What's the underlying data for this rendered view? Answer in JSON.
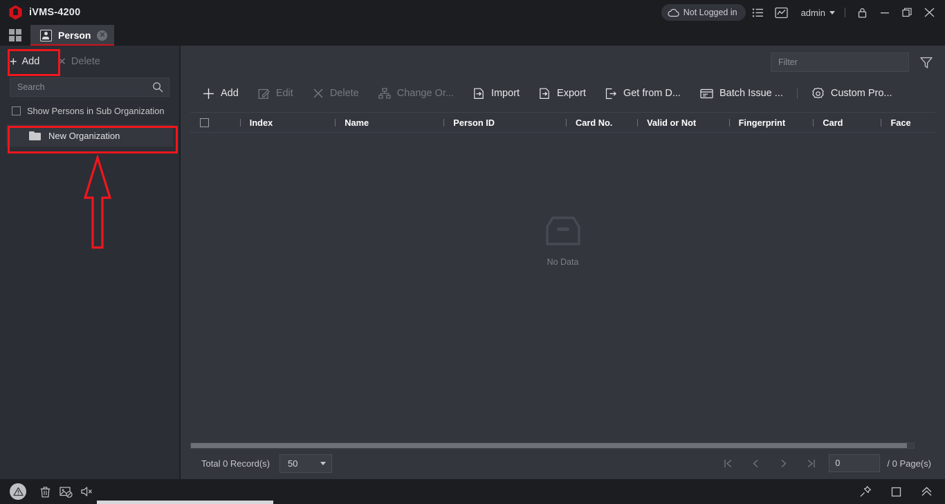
{
  "app": {
    "title": "iVMS-4200",
    "logo_color": "#d1121a",
    "accent_color": "#d1121a",
    "annotation_color": "#f0161d"
  },
  "titlebar": {
    "cloud_status": "Not Logged in",
    "cloud_icon": "cloud-icon",
    "list_icon": "list-icon",
    "chart_icon": "chart-icon",
    "user": "admin",
    "user_caret_icon": "chevron-down-icon",
    "lock_icon": "lock-icon",
    "minimize_icon": "minimize-icon",
    "maximize_icon": "maximize-icon",
    "close_icon": "close-icon"
  },
  "tabbar": {
    "grid_icon": "grid-icon",
    "tabs": [
      {
        "label": "Person",
        "icon": "person-icon",
        "close_icon": "close-icon",
        "active": true
      }
    ]
  },
  "sidebar": {
    "add_label": "Add",
    "add_icon": "plus-icon",
    "delete_label": "Delete",
    "delete_icon": "close-icon",
    "delete_disabled": true,
    "search": {
      "value": "",
      "placeholder": "Search",
      "icon": "search-icon"
    },
    "checkbox_label": "Show Persons in Sub Organization",
    "checkbox_checked": false,
    "organizations": [
      {
        "label": "New Organization",
        "icon": "folder-icon",
        "selected": true
      }
    ]
  },
  "main": {
    "filter": {
      "value": "",
      "placeholder": "Filter",
      "icon": "filter-funnel-icon"
    },
    "toolbar": [
      {
        "label": "Add",
        "icon": "plus-icon",
        "disabled": false
      },
      {
        "label": "Edit",
        "icon": "edit-pencil-icon",
        "disabled": true
      },
      {
        "label": "Delete",
        "icon": "close-icon",
        "disabled": true
      },
      {
        "label": "Change Or...",
        "icon": "org-tree-icon",
        "disabled": true
      },
      {
        "label": "Import",
        "icon": "import-icon",
        "disabled": false
      },
      {
        "label": "Export",
        "icon": "export-icon",
        "disabled": false
      },
      {
        "label": "Get from D...",
        "icon": "get-from-device-icon",
        "disabled": false
      },
      {
        "label": "Batch Issue ...",
        "icon": "card-icon",
        "disabled": false
      },
      {
        "label": "Custom Pro...",
        "icon": "gear-icon",
        "disabled": false
      }
    ],
    "table": {
      "select_all_checked": false,
      "columns": [
        "Index",
        "Name",
        "Person ID",
        "Card No.",
        "Valid or Not",
        "Fingerprint",
        "Card",
        "Face"
      ],
      "rows": [],
      "empty_icon": "empty-box-icon",
      "empty_text": "No Data"
    },
    "pagination": {
      "total_label": "Total 0 Record(s)",
      "page_size": "50",
      "page_size_caret_icon": "chevron-down-icon",
      "first_icon": "first-page-icon",
      "prev_icon": "prev-page-icon",
      "next_icon": "next-page-icon",
      "last_icon": "last-page-icon",
      "current_page": "0",
      "total_pages_label": "/ 0 Page(s)"
    }
  },
  "statusbar": {
    "alert_icon": "alert-triangle-icon",
    "trash_icon": "trash-icon",
    "image-block_icon": "image-blocked-icon",
    "mute_icon": "speaker-muted-icon",
    "pin_icon": "pin-icon",
    "window_icon": "window-square-icon",
    "expand_icon": "chevron-double-up-icon"
  }
}
